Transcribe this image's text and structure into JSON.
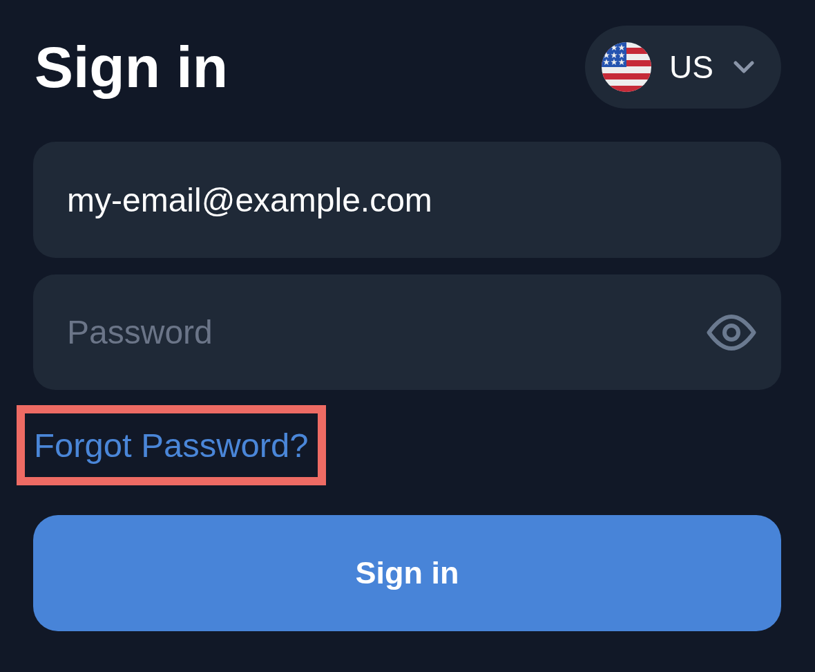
{
  "title": "Sign in",
  "country_selector": {
    "label": "US"
  },
  "email_field": {
    "value": "my-email@example.com"
  },
  "password_field": {
    "placeholder": "Password"
  },
  "forgot_password_link": {
    "label": "Forgot Password?",
    "highlighted": true
  },
  "sign_in_button": {
    "label": "Sign in"
  }
}
